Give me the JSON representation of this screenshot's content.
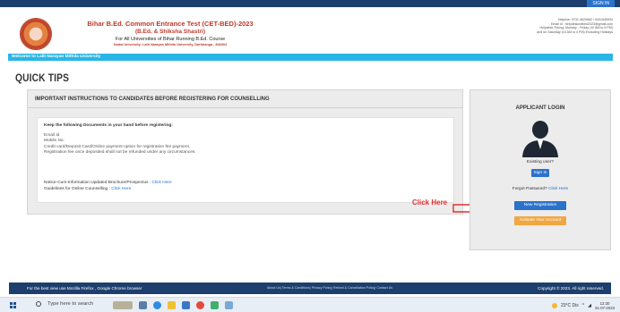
{
  "topbar": {
    "signin_label": "SIGN IN"
  },
  "header": {
    "title": "Bihar B.Ed. Common Entrance Test (CET-BED)-2023",
    "subtitle": "(B.Ed. & Shiksha Shastri)",
    "line3": "For All Universities of Bihar Running B.Ed. Course",
    "line4": "Nodal University: Lalit Narayan Mithila University, Darbhanga - 846004",
    "helpline": [
      "Helpline: 0731-4620682 / 9431545994",
      "Email id : helpdeskcetbed2023@gmail.com",
      "Helpdesk Timing: Monday - Friday (10 AM to 6 PM)",
      "and on Saturday (10 AM to 4 PM) Excluding Holidays"
    ]
  },
  "welcome": "Welcome to Lalit Narayan Mithila University",
  "quick_tips_title": "QUICK TIPS",
  "instructions": {
    "heading": "IMPORTANT INSTRUCTIONS TO CANDIDATES BEFORE REGISTERING FOR COUNSELLING",
    "lead": "Keep the following Documents in your hand before registering:",
    "documents": [
      "Email Id",
      "Mobile No.",
      "Credit card/Deposit Card/Online payment option for registration fee payment.",
      "Registration fee once deposited shall not be refunded under any circumstances."
    ],
    "notice_label": "Notice-Cum-Information Updated Brochure/Prospectus : ",
    "notice_link": "Click Here",
    "guidelines_label": "Guidelines for Online Counselling : ",
    "guidelines_link": "Click Here"
  },
  "annotation": {
    "text": "Click Here",
    "color": "#e03030"
  },
  "login": {
    "title": "APPLICANT LOGIN",
    "existing_user": "Existing user?",
    "signin_button": "Sign In",
    "forgot_label": "Forgot Password? ",
    "forgot_link": "Click Here",
    "new_registration_button": "New Registration",
    "activate_button": "Activate Your Account"
  },
  "footer": {
    "left": "For the best view use Mozilla Firefox , Google Chrome browser",
    "middle": "About Us| Terms & Conditions| Privacy Policy| Refund & Cancellation Policy| Contact Us",
    "right": "Copyright © 2023. All right reserved."
  },
  "taskbar": {
    "search_placeholder": "Type here to search",
    "weather": "23°C Dis",
    "time": "12:30",
    "date": "31-07-2023"
  },
  "colors": {
    "navy": "#1d3f6e",
    "welcome_bar": "#29b6e6",
    "primary_button": "#2b72c9",
    "activate_button": "#f0a742",
    "header_red": "#c0392b"
  }
}
